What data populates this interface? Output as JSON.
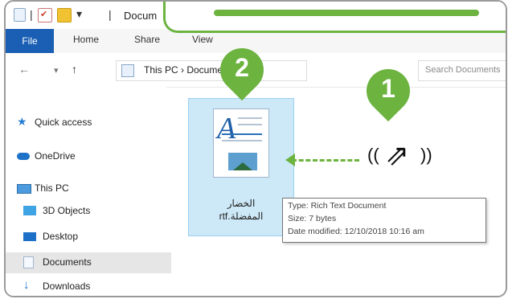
{
  "window": {
    "title": "Docum"
  },
  "ribbon": {
    "tabs": [
      {
        "label": "File"
      },
      {
        "label": "Home"
      },
      {
        "label": "Share"
      },
      {
        "label": "View"
      }
    ]
  },
  "address": {
    "path_text": "This PC  ›  Documents",
    "search_placeholder": "Search Documents"
  },
  "sidebar": {
    "items": [
      {
        "label": "Quick access",
        "icon": "star-icon"
      },
      {
        "label": "OneDrive",
        "icon": "cloud-icon"
      },
      {
        "label": "This PC",
        "icon": "computer-icon"
      },
      {
        "label": "3D Objects",
        "icon": "cube-icon"
      },
      {
        "label": "Desktop",
        "icon": "desktop-icon"
      },
      {
        "label": "Documents",
        "icon": "document-icon"
      },
      {
        "label": "Downloads",
        "icon": "download-icon"
      }
    ]
  },
  "file": {
    "name_line1": "الخضار",
    "name_line2": "المفضلة.rtf"
  },
  "tooltip": {
    "type": "Type: Rich Text Document",
    "size": "Size: 7 bytes",
    "date": "Date modified: 12/10/2018 10:16 am"
  },
  "callouts": {
    "step1": "1",
    "step2": "2"
  },
  "colors": {
    "accent_green": "#6cb33f",
    "file_blue": "#1a5fb4",
    "selection": "#cde8f7"
  }
}
